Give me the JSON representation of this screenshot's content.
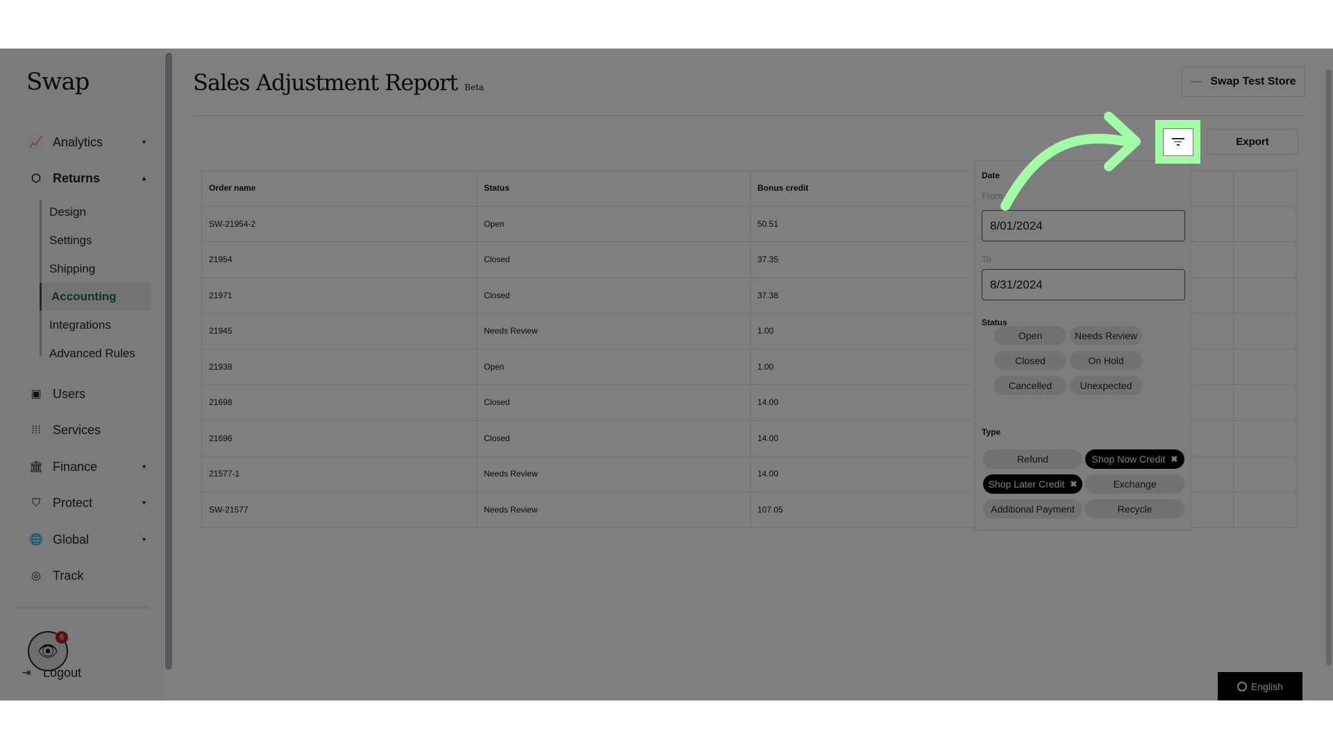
{
  "sidebar": {
    "logo": "Swap",
    "items": [
      {
        "label": "Analytics",
        "icon": "chart-icon",
        "caret": "▾"
      },
      {
        "label": "Returns",
        "icon": "box-icon",
        "caret": "▴"
      },
      {
        "label": "Users",
        "icon": "user-card-icon"
      },
      {
        "label": "Services",
        "icon": "grid-icon"
      },
      {
        "label": "Finance",
        "icon": "bank-icon",
        "caret": "▾"
      },
      {
        "label": "Protect",
        "icon": "shield-icon",
        "caret": "▾"
      },
      {
        "label": "Global",
        "icon": "globe-icon",
        "caret": "▾"
      },
      {
        "label": "Track",
        "icon": "target-icon"
      }
    ],
    "returns_sub": [
      "Design",
      "Settings",
      "Shipping",
      "Accounting",
      "Integrations",
      "Advanced Rules"
    ],
    "active_sub": "Accounting",
    "logout": "Logout",
    "notification_count": "6"
  },
  "header": {
    "title": "Sales Adjustment Report",
    "badge": "Beta",
    "store": "Swap Test Store"
  },
  "toolbar": {
    "export": "Export",
    "filter_icon": "filter-icon"
  },
  "table": {
    "columns": [
      "Order name",
      "Status",
      "Bonus credit",
      ""
    ],
    "rows": [
      [
        "SW-21954-2",
        "Open",
        "50.51"
      ],
      [
        "21954",
        "Closed",
        "37.35"
      ],
      [
        "21971",
        "Closed",
        "37.38"
      ],
      [
        "21945",
        "Needs Review",
        "1.00"
      ],
      [
        "21938",
        "Open",
        "1.00"
      ],
      [
        "21698",
        "Closed",
        "14.00"
      ],
      [
        "21696",
        "Closed",
        "14.00"
      ],
      [
        "21577-1",
        "Needs Review",
        "14.00"
      ],
      [
        "SW-21577",
        "Needs Review",
        "107.05"
      ]
    ]
  },
  "filter": {
    "date_label": "Date",
    "from_label": "From",
    "from_value": "8/01/2024",
    "to_label": "To",
    "to_value": "8/31/2024",
    "status_label": "Status",
    "status_options": [
      "Open",
      "Needs Review",
      "Closed",
      "On Hold",
      "Cancelled",
      "Unexpected"
    ],
    "type_label": "Type",
    "type_options": [
      {
        "label": "Refund",
        "selected": false
      },
      {
        "label": "Shop Now Credit",
        "selected": true
      },
      {
        "label": "Shop Later Credit",
        "selected": true
      },
      {
        "label": "Exchange",
        "selected": false
      },
      {
        "label": "Additional Payment",
        "selected": false
      },
      {
        "label": "Recycle",
        "selected": false
      }
    ],
    "remove_glyph": "✖"
  },
  "language": "English",
  "colors": {
    "highlight": "#a3fca8",
    "active_nav": "#1e6b44",
    "selected_chip": "#000000"
  }
}
